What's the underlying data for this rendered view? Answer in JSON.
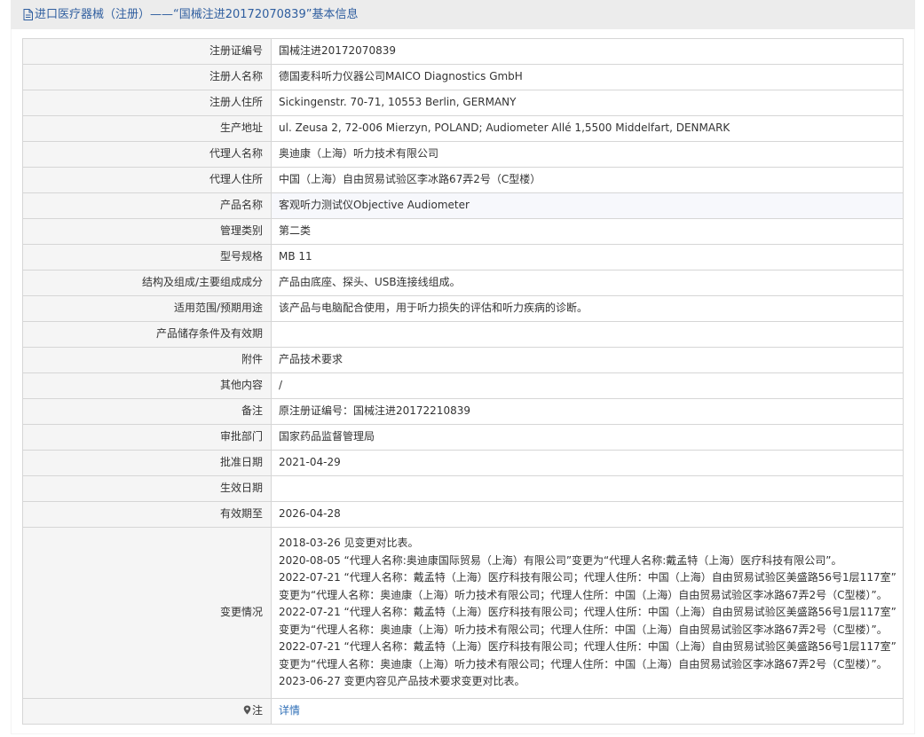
{
  "header": {
    "title": "进口医疗器械（注册）——“国械注进20172070839”基本信息"
  },
  "rows": [
    {
      "label": "注册证编号",
      "value": "国械注进20172070839"
    },
    {
      "label": "注册人名称",
      "value": "德国麦科听力仪器公司MAICO Diagnostics GmbH"
    },
    {
      "label": "注册人住所",
      "value": "Sickingenstr. 70-71, 10553 Berlin, GERMANY"
    },
    {
      "label": "生产地址",
      "value": "ul. Zeusa 2, 72-006 Mierzyn, POLAND; Audiometer Allé 1,5500 Middelfart, DENMARK"
    },
    {
      "label": "代理人名称",
      "value": "奥迪康（上海）听力技术有限公司"
    },
    {
      "label": "代理人住所",
      "value": "中国（上海）自由贸易试验区李冰路67弄2号（C型楼）"
    },
    {
      "label": "产品名称",
      "value": "客观听力测试仪Objective Audiometer"
    },
    {
      "label": "管理类别",
      "value": "第二类"
    },
    {
      "label": "型号规格",
      "value": "MB 11"
    },
    {
      "label": "结构及组成/主要组成成分",
      "value": "产品由底座、探头、USB连接线组成。"
    },
    {
      "label": "适用范围/预期用途",
      "value": "该产品与电脑配合使用，用于听力损失的评估和听力疾病的诊断。"
    },
    {
      "label": "产品储存条件及有效期",
      "value": ""
    },
    {
      "label": "附件",
      "value": "产品技术要求"
    },
    {
      "label": "其他内容",
      "value": "/"
    },
    {
      "label": "备注",
      "value": "原注册证编号：国械注进20172210839"
    },
    {
      "label": "审批部门",
      "value": "国家药品监督管理局"
    },
    {
      "label": "批准日期",
      "value": "2021-04-29"
    },
    {
      "label": "生效日期",
      "value": ""
    },
    {
      "label": "有效期至",
      "value": "2026-04-28"
    }
  ],
  "changes": {
    "label": "变更情况",
    "lines": [
      "2018-03-26 见变更对比表。",
      "2020-08-05 “代理人名称:奥迪康国际贸易（上海）有限公司”变更为“代理人名称:戴孟特（上海）医疗科技有限公司”。",
      "2022-07-21 “代理人名称：戴孟特（上海）医疗科技有限公司；代理人住所：中国（上海）自由贸易试验区美盛路56号1层117室”",
      "变更为“代理人名称：奥迪康（上海）听力技术有限公司；代理人住所：中国（上海）自由贸易试验区李冰路67弄2号（C型楼）”。",
      "2022-07-21 “代理人名称：戴孟特（上海）医疗科技有限公司；代理人住所：中国（上海）自由贸易试验区美盛路56号1层117室”",
      "变更为“代理人名称：奥迪康（上海）听力技术有限公司；代理人住所：中国（上海）自由贸易试验区李冰路67弄2号（C型楼）”。",
      "2022-07-21 “代理人名称：戴孟特（上海）医疗科技有限公司；代理人住所：中国（上海）自由贸易试验区美盛路56号1层117室”",
      "变更为“代理人名称：奥迪康（上海）听力技术有限公司；代理人住所：中国（上海）自由贸易试验区李冰路67弄2号（C型楼）”。",
      "2023-06-27 变更内容见产品技术要求变更对比表。"
    ]
  },
  "note": {
    "label": "注",
    "link_text": "详情",
    "icon": "pin-icon"
  },
  "colors": {
    "title": "#2f5e9f",
    "link": "#2f6fb7",
    "label_bg": "#f5f5f5",
    "border": "#d6d6d6",
    "highlight_row": "#f7f8fc"
  }
}
